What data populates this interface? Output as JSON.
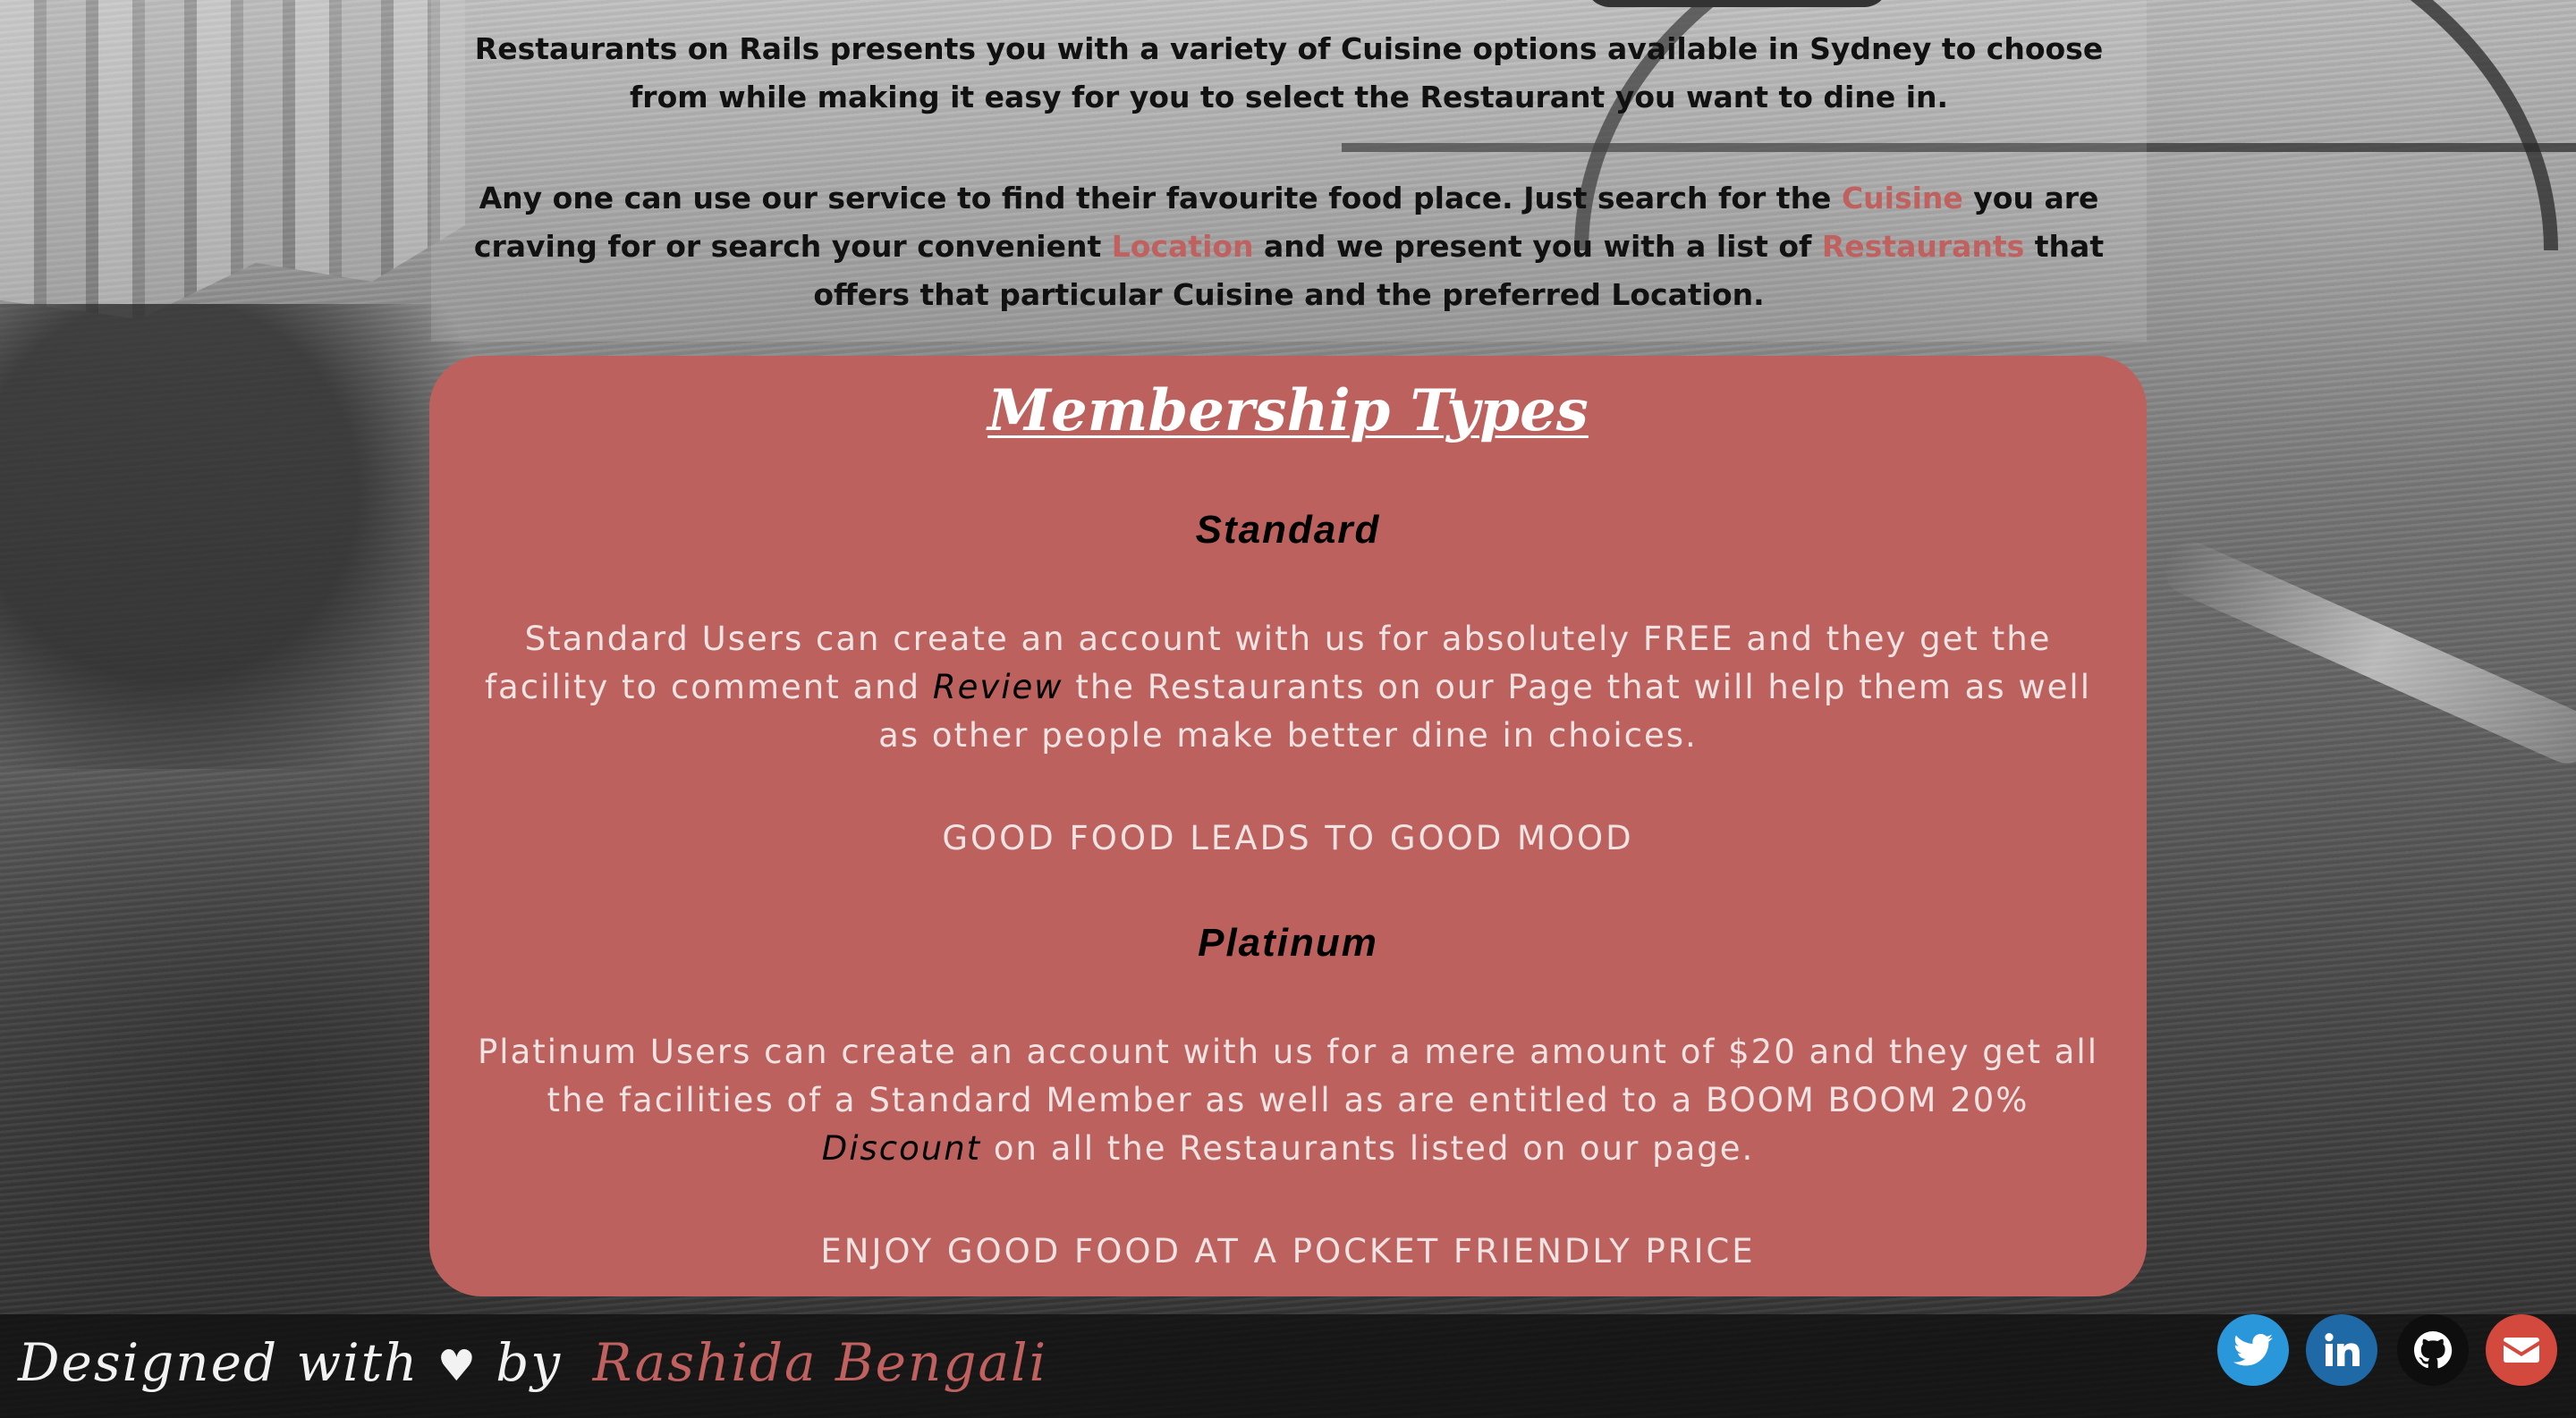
{
  "intro": {
    "p1": "Restaurants on Rails presents you with a variety of Cuisine options available in Sydney to choose from while making it easy for you to select the Restaurant you want to dine in.",
    "p2_a": "Any one can use our service to find their favourite food place. Just search for the ",
    "p2_cuisine": "Cuisine",
    "p2_b": " you are craving for or search your convenient ",
    "p2_location": "Location",
    "p2_c": " and we present you with a list of ",
    "p2_restaurants": "Restaurants",
    "p2_d": " that offers that particular Cuisine and the preferred Location."
  },
  "membership": {
    "title": "Membership Types",
    "standard": {
      "name": "Standard",
      "desc_a": "Standard Users can create an account with us for absolutely FREE and they get the facility to comment and ",
      "desc_em": "Review",
      "desc_b": " the Restaurants on our Page that will help them as well as other people make better dine in choices.",
      "motto": "GOOD FOOD LEADS TO GOOD MOOD"
    },
    "platinum": {
      "name": "Platinum",
      "desc_a": "Platinum Users can create an account with us for a mere amount of $20 and they get all the facilities of a Standard Member as well as are entitled to a BOOM BOOM 20% ",
      "desc_em": "Discount",
      "desc_b": " on all the Restaurants listed on our page.",
      "motto": "ENJOY GOOD FOOD AT A POCKET FRIENDLY PRICE"
    }
  },
  "footer": {
    "credit_prefix": "Designed with",
    "heart": "♥",
    "by": "by",
    "author": "Rashida Bengali",
    "icons": [
      "twitter-icon",
      "linkedin-icon",
      "github-icon",
      "email-icon"
    ]
  },
  "colors": {
    "accent": "#c0605f",
    "card": "#bd615e",
    "twitter": "#2a97db",
    "linkedin": "#1f6aa6",
    "github": "#0e0e0e",
    "email": "#d4493d"
  }
}
